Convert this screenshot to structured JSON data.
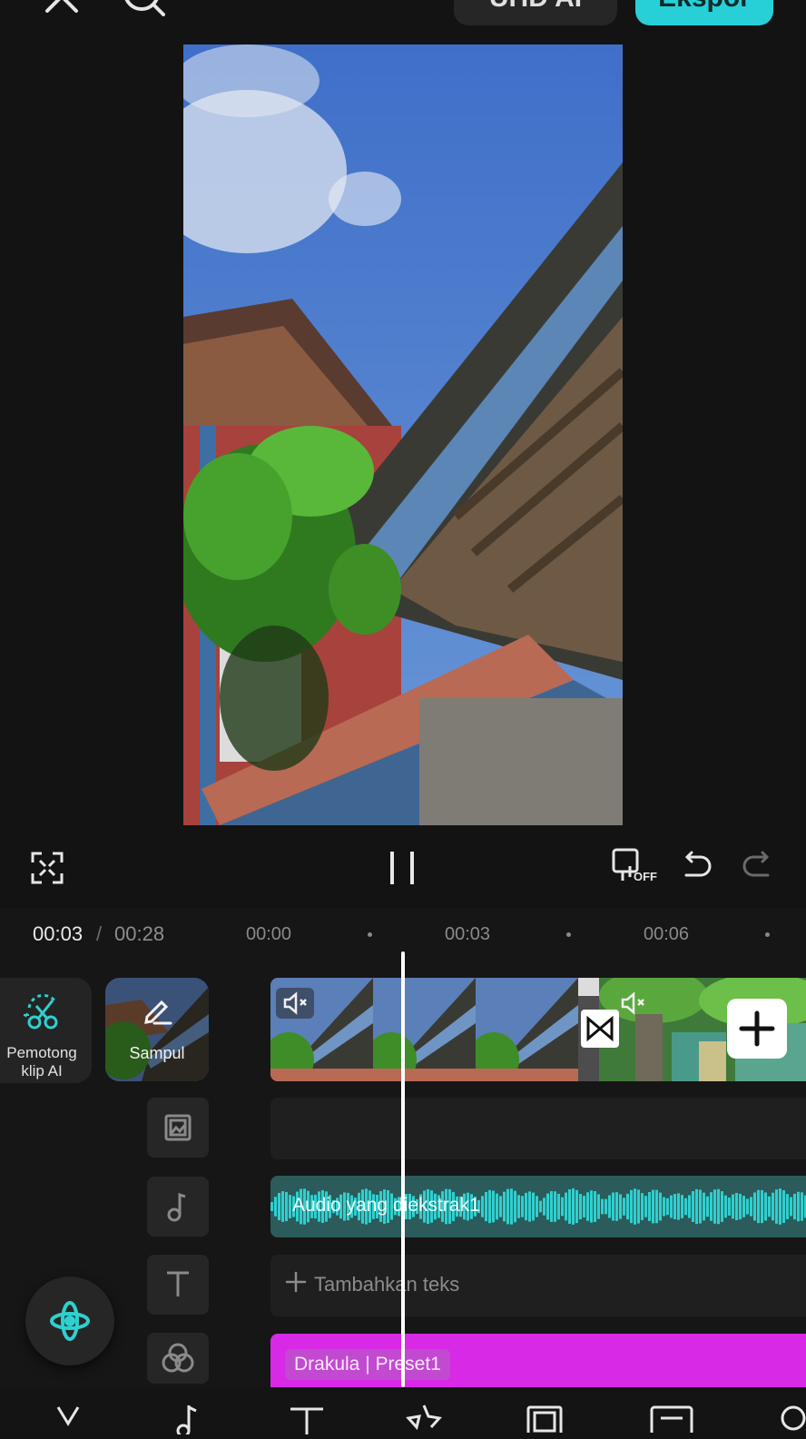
{
  "top_bar": {
    "close_icon": "close-icon",
    "search_icon": "search-icon",
    "uhd_ai_label": "UHD AI",
    "export_label": "Ekspor",
    "accent_color": "#27d0d6"
  },
  "preview": {
    "icons": [
      "fullscreen-icon",
      "pause-icon",
      "preview-off-icon",
      "undo-icon",
      "redo-icon"
    ],
    "off_badge": "OFF"
  },
  "timeline": {
    "current_time": "00:03",
    "separator": "/",
    "total_time": "00:28",
    "ruler_ticks": [
      "00:00",
      "00:03",
      "00:06"
    ]
  },
  "left_tools": {
    "ai_clip_cutter_label": "Pemotong klip AI",
    "cover_label": "Sampul"
  },
  "tracks": {
    "audio_label": "Audio yang diekstrak1",
    "add_text_label": "Tambahkan teks",
    "effect_label": "Drakula | Preset1",
    "audio_color": "#2fd0cf",
    "effect_color": "#d829e6"
  },
  "bottom_toolbar": {
    "icons": [
      "cut-icon",
      "music-icon",
      "text-icon",
      "sticker-icon",
      "overlay-icon",
      "caption-icon",
      "filter-icon"
    ]
  }
}
